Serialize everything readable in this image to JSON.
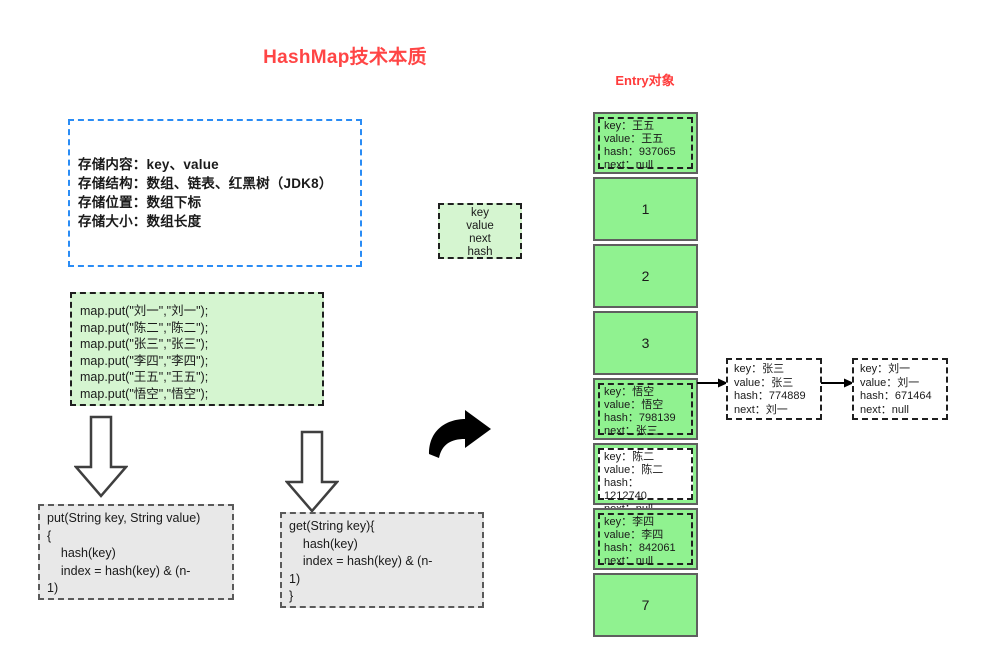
{
  "page_title": "HashMap技术本质",
  "entry_title": "Entry对象",
  "info_box": {
    "lines": [
      "存储内容：key、value",
      "存储结构：数组、链表、红黑树（JDK8）",
      "存储位置：数组下标",
      "存储大小：数组长度"
    ]
  },
  "code_box": {
    "lines": [
      "map.put(\"刘一\",\"刘一\");",
      "map.put(\"陈二\",\"陈二\");",
      "map.put(\"张三\",\"张三\");",
      "map.put(\"李四\",\"李四\");",
      "map.put(\"王五\",\"王五\");",
      "map.put(\"悟空\",\"悟空\");"
    ]
  },
  "entry_fields_box": {
    "lines": [
      "key",
      "value",
      "next",
      "hash"
    ]
  },
  "methods": {
    "put": "put(String key, String value)\n{\n    hash(key)\n    index = hash(key) & (n-\n1)\n}",
    "get": "get(String key){\n    hash(key)\n    index = hash(key) & (n-\n1)\n}"
  },
  "hash_array": {
    "cells": [
      {
        "index": "0",
        "filled": true,
        "overflow": false,
        "entry": {
          "key": "key：王五",
          "value": "value：王五",
          "hash": "hash：937065",
          "next": "next：null"
        }
      },
      {
        "index": "1",
        "filled": false
      },
      {
        "index": "2",
        "filled": false
      },
      {
        "index": "3",
        "filled": false
      },
      {
        "index": "4",
        "filled": true,
        "overflow": false,
        "entry": {
          "key": "key：悟空",
          "value": "value：悟空",
          "hash": "hash：798139",
          "next": "next：张三"
        }
      },
      {
        "index": "5",
        "filled": true,
        "overflow": true,
        "entry": {
          "key": "key：陈二",
          "value": "value：陈二",
          "hash": "hash：",
          "hash2": "1212740",
          "next": "next：null"
        }
      },
      {
        "index": "6",
        "filled": true,
        "overflow": false,
        "entry": {
          "key": "key：李四",
          "value": "value：李四",
          "hash": "hash：842061",
          "next": "next：null"
        }
      },
      {
        "index": "7",
        "filled": false
      }
    ]
  },
  "linked_nodes": [
    {
      "key": "key：张三",
      "value": "value：张三",
      "hash": "hash：774889",
      "next": "next：刘一"
    },
    {
      "key": "key：刘一",
      "value": "value：刘一",
      "hash": "hash：671464",
      "next": "next：null"
    }
  ],
  "colors": {
    "title_red": "#ff4545",
    "entry_title_red": "#ff3b3b",
    "info_border_blue": "#2a8cf5",
    "cell_green": "#90f290",
    "code_green": "#d5f5d0",
    "method_gray": "#e8e8e8"
  }
}
